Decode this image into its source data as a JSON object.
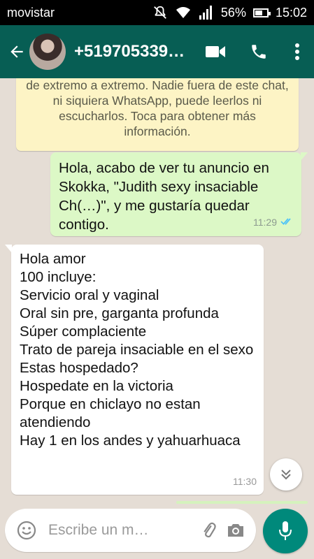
{
  "status_bar": {
    "carrier": "movistar",
    "battery": "56%",
    "battery_level": 0.56,
    "time": "15:02"
  },
  "header": {
    "contact": "+519705339…",
    "icons": [
      "arrow-back-icon",
      "video-call-icon",
      "phone-icon",
      "more-vert-icon"
    ]
  },
  "chat": {
    "encryption_notice": "de extremo a extremo. Nadie fuera de este chat, ni siquiera WhatsApp, puede leerlos ni escucharlos. Toca para obtener más información.",
    "messages": [
      {
        "direction": "outgoing",
        "text": "Hola, acabo de ver tu anuncio en Skokka, \"Judith sexy insaciable Ch(…)\", y me gustaría quedar contigo.",
        "time": "11:29",
        "status": "read"
      },
      {
        "direction": "incoming",
        "text": "Hola amor\n100 incluye:\nServicio oral y vaginal\nOral sin pre, garganta profunda\nSúper complaciente\nTrato de pareja insaciable en el sexo\nEstas hospedado?\nHospedate en la victoria\nPorque en chiclayo no estan atendiendo\nHay 1 en los andes y yahuarhuaca",
        "time": "11:30"
      }
    ]
  },
  "composer": {
    "placeholder": "Escribe un m…",
    "icons": [
      "emoji-icon",
      "attach-icon",
      "camera-icon",
      "mic-icon"
    ]
  },
  "colors": {
    "header": "#075e54",
    "outgoing_bubble": "#dcf8c6",
    "notice_bubble": "#fdf4c5",
    "accent": "#00897b",
    "read_ticks": "#4fc3f7"
  }
}
